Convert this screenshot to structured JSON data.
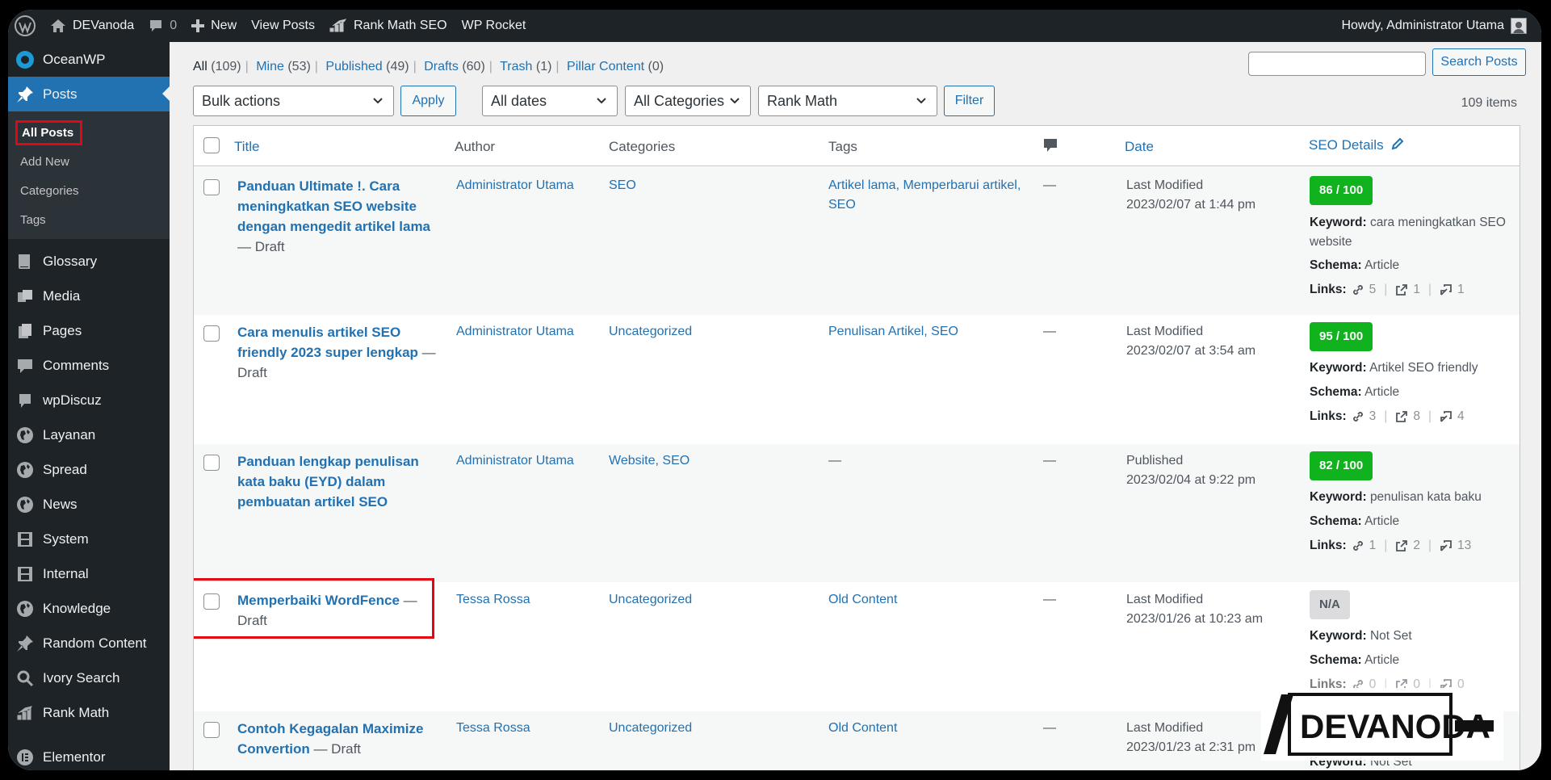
{
  "adminbar": {
    "site_name": "DEVanoda",
    "comments_count": "0",
    "new_label": "New",
    "view_posts_label": "View Posts",
    "rank_math_label": "Rank Math SEO",
    "wp_rocket_label": "WP Rocket",
    "howdy": "Howdy, Administrator Utama"
  },
  "sidebar": {
    "top_item": "OceanWP",
    "posts_label": "Posts",
    "submenu": [
      "All Posts",
      "Add New",
      "Categories",
      "Tags"
    ],
    "items": [
      "Glossary",
      "Media",
      "Pages",
      "Comments",
      "wpDiscuz",
      "Layanan",
      "Spread",
      "News",
      "System",
      "Internal",
      "Knowledge",
      "Random Content",
      "Ivory Search",
      "Rank Math"
    ],
    "bottom_item": "Elementor"
  },
  "filters": {
    "views": [
      {
        "label": "All",
        "count": "(109)"
      },
      {
        "label": "Mine",
        "count": "(53)"
      },
      {
        "label": "Published",
        "count": "(49)"
      },
      {
        "label": "Drafts",
        "count": "(60)"
      },
      {
        "label": "Trash",
        "count": "(1)"
      },
      {
        "label": "Pillar Content",
        "count": "(0)"
      }
    ],
    "search_button": "Search Posts",
    "bulk_actions": "Bulk actions",
    "apply": "Apply",
    "all_dates": "All dates",
    "all_categories": "All Categories",
    "rank_math": "Rank Math",
    "filter": "Filter",
    "items_count": "109 items"
  },
  "table": {
    "headers": {
      "title": "Title",
      "author": "Author",
      "categories": "Categories",
      "tags": "Tags",
      "date": "Date",
      "seo": "SEO Details"
    },
    "rows": [
      {
        "title": "Panduan Ultimate !. Cara meningkatkan SEO website dengan mengedit artikel lama",
        "state": " — Draft",
        "author": "Administrator Utama",
        "categories": "SEO",
        "tags": "Artikel lama, Memperbarui artikel, SEO",
        "comments": "—",
        "date_status": "Last Modified",
        "date": "2023/02/07 at 1:44 pm",
        "score": "86 / 100",
        "keyword_label": "Keyword:",
        "keyword": "cara meningkatkan SEO website",
        "schema_label": "Schema:",
        "schema": "Article",
        "links_label": "Links:",
        "links_internal": "5",
        "links_external": "1",
        "links_incoming": "1"
      },
      {
        "title": "Cara menulis artikel SEO friendly 2023 super lengkap",
        "state": " — Draft",
        "author": "Administrator Utama",
        "categories": "Uncategorized",
        "tags": "Penulisan Artikel, SEO",
        "comments": "—",
        "date_status": "Last Modified",
        "date": "2023/02/07 at 3:54 am",
        "score": "95 / 100",
        "keyword_label": "Keyword:",
        "keyword": "Artikel SEO friendly",
        "schema_label": "Schema:",
        "schema": "Article",
        "links_label": "Links:",
        "links_internal": "3",
        "links_external": "8",
        "links_incoming": "4"
      },
      {
        "title": "Panduan lengkap penulisan kata baku (EYD) dalam pembuatan artikel SEO",
        "state": "",
        "author": "Administrator Utama",
        "categories": "Website, SEO",
        "tags": "—",
        "comments": "—",
        "date_status": "Published",
        "date": "2023/02/04 at 9:22 pm",
        "score": "82 / 100",
        "keyword_label": "Keyword:",
        "keyword": "penulisan kata baku",
        "schema_label": "Schema:",
        "schema": "Article",
        "links_label": "Links:",
        "links_internal": "1",
        "links_external": "2",
        "links_incoming": "13"
      },
      {
        "title": "Memperbaiki WordFence",
        "state": " — Draft",
        "author": "Tessa Rossa",
        "categories": "Uncategorized",
        "tags": "Old Content",
        "comments": "—",
        "date_status": "Last Modified",
        "date": "2023/01/26 at 10:23 am",
        "score": "N/A",
        "keyword_label": "Keyword:",
        "keyword": "Not Set",
        "schema_label": "Schema:",
        "schema": "Article",
        "links_label": "Links:",
        "links_internal": "0",
        "links_external": "0",
        "links_incoming": "0"
      },
      {
        "title": "Contoh Kegagalan Maximize Convertion",
        "state": " — Draft",
        "author": "Tessa Rossa",
        "categories": "Uncategorized",
        "tags": "Old Content",
        "comments": "—",
        "date_status": "Last Modified",
        "date": "2023/01/23 at 2:31 pm",
        "keyword_label": "Keyword:",
        "keyword": "Not Set"
      }
    ]
  },
  "watermark": {
    "text_left": "DEV",
    "text_right": "ANODA"
  }
}
